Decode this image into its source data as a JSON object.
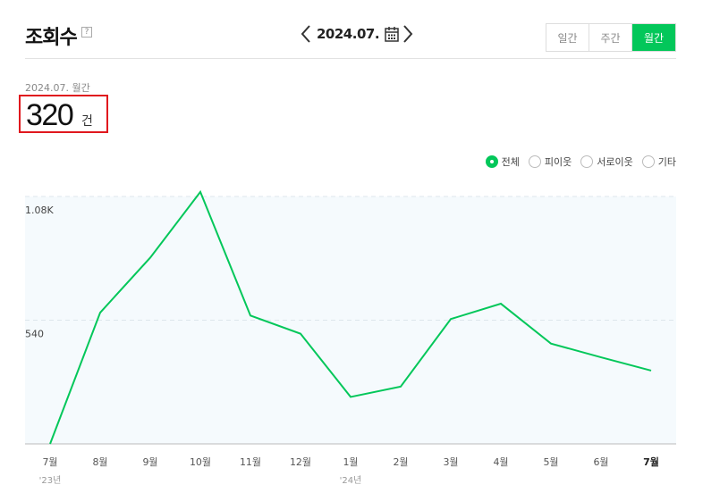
{
  "header": {
    "title": "조회수",
    "help_glyph": "?",
    "date": "2024.07.",
    "period_tabs": [
      {
        "label": "일간",
        "active": false
      },
      {
        "label": "주간",
        "active": false
      },
      {
        "label": "월간",
        "active": true
      }
    ]
  },
  "summary": {
    "period_label": "2024.07. 월간",
    "count": "320",
    "unit": "건"
  },
  "legend": [
    {
      "label": "전체",
      "checked": true
    },
    {
      "label": "피이웃",
      "checked": false
    },
    {
      "label": "서로이웃",
      "checked": false
    },
    {
      "label": "기타",
      "checked": false
    }
  ],
  "colors": {
    "accent": "#03c75a",
    "highlight_border": "#e0181e",
    "plot_bg": "#f5fafd"
  },
  "chart_data": {
    "type": "line",
    "categories": [
      "7월",
      "8월",
      "9월",
      "10월",
      "11월",
      "12월",
      "1월",
      "2월",
      "3월",
      "4월",
      "5월",
      "6월",
      "7월"
    ],
    "year_labels": [
      {
        "index": 0,
        "label": "'23년"
      },
      {
        "index": 6,
        "label": "'24년"
      }
    ],
    "bold_category_index": 12,
    "series": [
      {
        "values": [
          0,
          573,
          813,
          1100,
          560,
          481,
          205,
          250,
          545,
          612,
          438,
          378,
          320
        ]
      }
    ],
    "yticks": [
      {
        "value": 1080,
        "label": "1.08K"
      },
      {
        "value": 540,
        "label": "540"
      }
    ],
    "ylim": [
      0,
      1080
    ],
    "grid": true
  }
}
